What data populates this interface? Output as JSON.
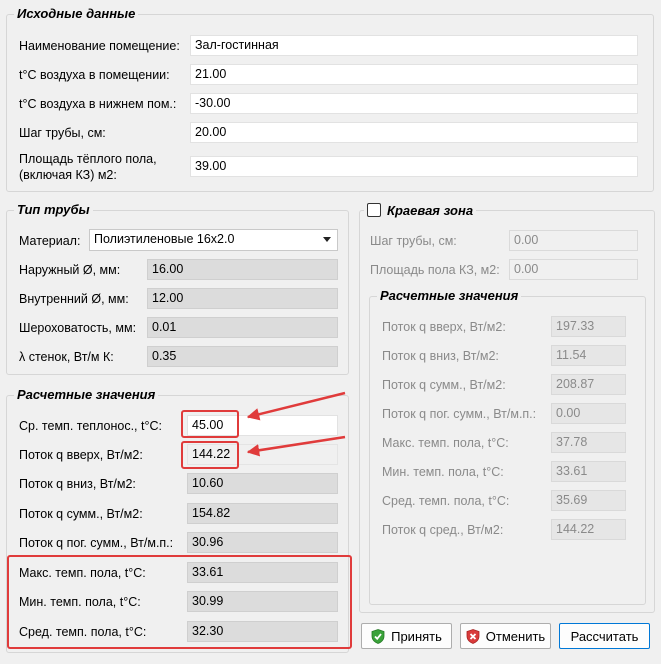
{
  "source": {
    "title": "Исходные данные",
    "fields": [
      {
        "label": "Наименование помещение:",
        "value": "Зал-гостинная"
      },
      {
        "label": "t°C воздуха в помещении:",
        "value": "21.00"
      },
      {
        "label": "t°C воздуха в нижнем пом.:",
        "value": "-30.00"
      },
      {
        "label": "Шаг трубы, см:",
        "value": "20.00"
      },
      {
        "label_line1": "Площадь тёплого пола,",
        "label_line2": "(включая КЗ) м2:",
        "value": "39.00"
      }
    ]
  },
  "pipe": {
    "title": "Тип трубы",
    "material_label": "Материал:",
    "material_value": "Полиэтиленовые 16x2.0",
    "fields": [
      {
        "label": "Наружный Ø, мм:",
        "value": "16.00"
      },
      {
        "label": "Внутренний Ø, мм:",
        "value": "12.00"
      },
      {
        "label": "Шероховатость, мм:",
        "value": "0.01"
      },
      {
        "label": "λ стенок, Вт/м К:",
        "value": "0.35"
      }
    ]
  },
  "calc": {
    "title": "Расчетные значения",
    "fields": [
      {
        "label": "Ср. темп. теплонос., t°C:",
        "value": "45.00"
      },
      {
        "label": "Поток q вверх, Вт/м2:",
        "value": "144.22"
      },
      {
        "label": "Поток q вниз, Вт/м2:",
        "value": "10.60"
      },
      {
        "label": "Поток q сумм., Вт/м2:",
        "value": "154.82"
      },
      {
        "label": "Поток q пог. сумм., Вт/м.п.:",
        "value": "30.96"
      },
      {
        "label": "Макс. темп. пола, t°C:",
        "value": "33.61"
      },
      {
        "label": "Мин. темп. пола, t°C:",
        "value": "30.99"
      },
      {
        "label": "Сред. темп. пола, t°C:",
        "value": "32.30"
      }
    ]
  },
  "edge": {
    "title": "Краевая зона",
    "fields": [
      {
        "label": "Шаг трубы, см:",
        "value": "0.00"
      },
      {
        "label": "Площадь пола КЗ, м2:",
        "value": "0.00"
      }
    ],
    "calc_title": "Расчетные значения",
    "calc_fields": [
      {
        "label": "Поток q вверх, Вт/м2:",
        "value": "197.33"
      },
      {
        "label": "Поток q вниз, Вт/м2:",
        "value": "11.54"
      },
      {
        "label": "Поток q сумм., Вт/м2:",
        "value": "208.87"
      },
      {
        "label": "Поток q пог. сумм., Вт/м.п.:",
        "value": "0.00"
      },
      {
        "label": "Макс. темп. пола, t°C:",
        "value": "37.78"
      },
      {
        "label": "Мин. темп. пола, t°C:",
        "value": "33.61"
      },
      {
        "label": "Сред. темп. пола, t°C:",
        "value": "35.69"
      },
      {
        "label": "Поток q сред., Вт/м2:",
        "value": "144.22"
      }
    ]
  },
  "buttons": {
    "accept": "Принять",
    "cancel": "Отменить",
    "calculate": "Рассчитать"
  },
  "colors": {
    "highlight": "#e03b3b",
    "accent": "#0078d7"
  },
  "icons": {
    "accept": "green-check-shield-icon",
    "cancel": "red-x-shield-icon"
  }
}
